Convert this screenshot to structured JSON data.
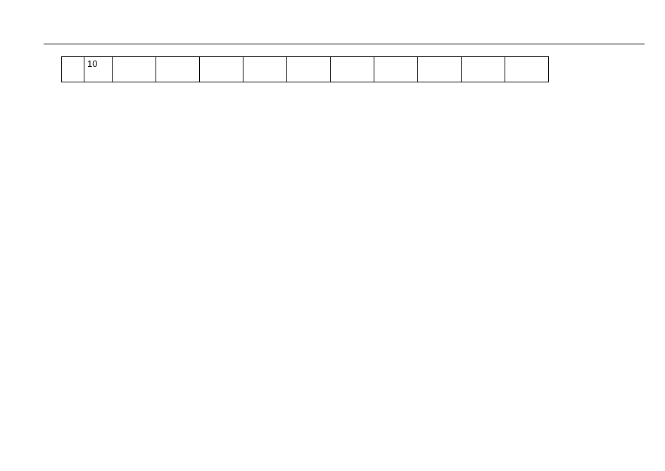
{
  "row": {
    "cells": [
      "",
      "10",
      "",
      "",
      "",
      "",
      "",
      "",
      "",
      "",
      "",
      ""
    ]
  }
}
